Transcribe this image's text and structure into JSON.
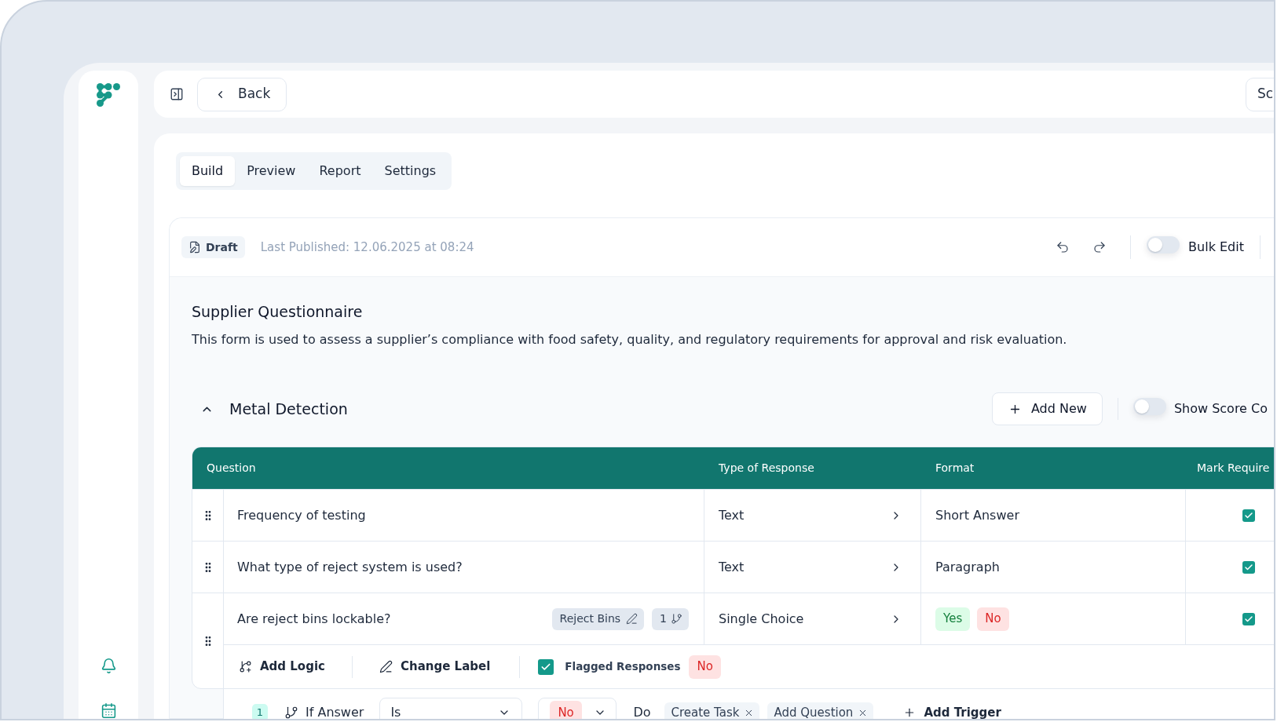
{
  "top_bar": {
    "back_button": "Back",
    "right_button": "Sc"
  },
  "tabs": [
    {
      "label": "Build",
      "selected": true
    },
    {
      "label": "Preview",
      "selected": false
    },
    {
      "label": "Report",
      "selected": false
    },
    {
      "label": "Settings",
      "selected": false
    }
  ],
  "form_header": {
    "status": "Draft",
    "last_published": "Last Published: 12.06.2025 at 08:24",
    "bulk_edit": {
      "label": "Bulk Edit",
      "on": false
    }
  },
  "form": {
    "title": "Supplier Questionnaire",
    "description": "This form is used to assess a supplier’s compliance with food safety, quality, and regulatory requirements for approval and risk evaluation."
  },
  "section": {
    "title": "Metal Detection",
    "expanded": true,
    "add_button": "Add New",
    "score_toggle": {
      "label": "Show Score Co",
      "on": false
    }
  },
  "table": {
    "columns": [
      "Question",
      "Type of Response",
      "Format",
      "Mark Require"
    ],
    "rows": [
      {
        "question": "Frequency of testing",
        "type": "Text",
        "format": {
          "kind": "text",
          "text": "Short Answer"
        },
        "required": true
      },
      {
        "question": "What type of reject system is used?",
        "type": "Text",
        "format": {
          "kind": "text",
          "text": "Paragraph"
        },
        "required": true
      },
      {
        "question": "Are reject bins lockable?",
        "label_tag": "Reject Bins",
        "logic_count": "1",
        "type": "Single Choice",
        "format": {
          "kind": "choices",
          "options": [
            {
              "label": "Yes",
              "color": "#dcfce7"
            },
            {
              "label": "No",
              "color": "#fee2e2"
            }
          ]
        },
        "required": true,
        "expanded": true,
        "logic_bar": {
          "actions": [
            {
              "kind": "add_logic",
              "label": "Add Logic"
            },
            {
              "kind": "change_label",
              "label": "Change Label"
            }
          ],
          "flagged": {
            "label": "Flagged Responses",
            "checked": true,
            "values": [
              {
                "label": "No",
                "color": "#fee2e2"
              }
            ]
          }
        },
        "logic_rules": [
          {
            "number": "1",
            "condition": "If Answer",
            "operator": "Is",
            "answer": {
              "label": "No",
              "color": "#fee2e2"
            },
            "then": "Do",
            "actions": [
              "Create Task",
              "Add Question"
            ],
            "add_trigger": "Add Trigger"
          }
        ]
      }
    ]
  }
}
